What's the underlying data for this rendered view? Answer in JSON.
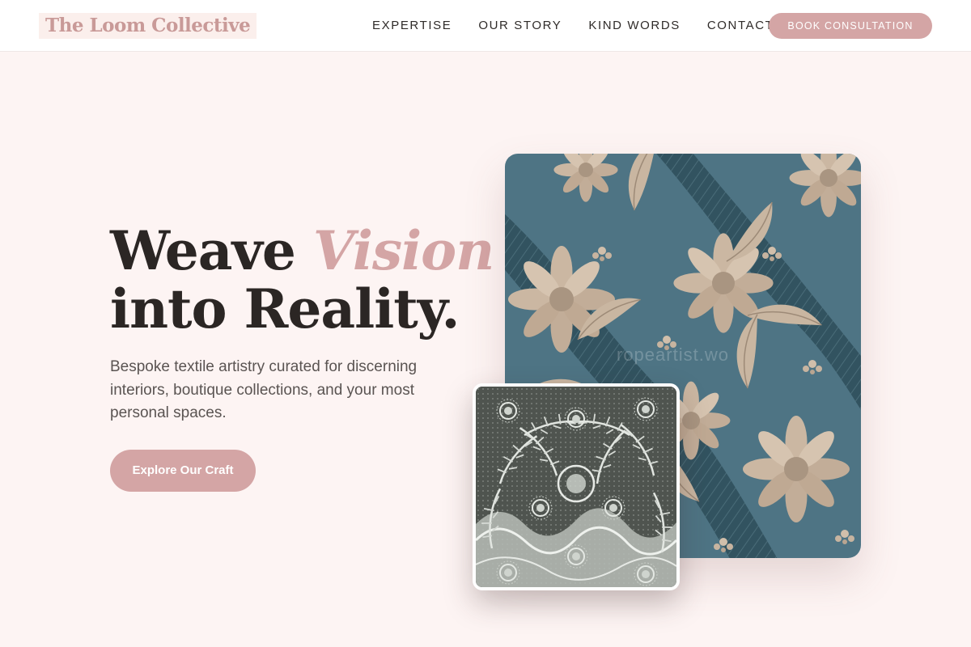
{
  "header": {
    "logo": "The Loom Collective",
    "nav": [
      "EXPERTISE",
      "OUR STORY",
      "KIND WORDS",
      "CONTACT"
    ],
    "cta": "BOOK CONSULTATION"
  },
  "hero": {
    "title_part1": "Weave",
    "title_accent": "Vision",
    "title_line2": "into Reality.",
    "subtitle": "Bespoke textile artistry curated for discerning interiors, boutique collections, and your most personal spaces.",
    "cta": "Explore Our Craft"
  },
  "images": {
    "main_watermark": "ropeartist.wo",
    "main_icon": "blue-floral-damask-fabric",
    "secondary_icon": "grey-lace-fabric"
  },
  "colors": {
    "accent": "#d4a5a5",
    "background": "#fdf4f3",
    "text": "#2b2624"
  }
}
